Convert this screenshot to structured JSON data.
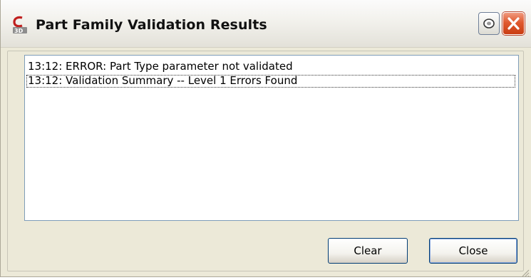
{
  "window": {
    "title": "Part Family Validation Results",
    "app_icon": "civil-3d-icon",
    "pin_icon": "pin-icon",
    "close_icon": "close-icon",
    "close_color": "#d9522a"
  },
  "results": {
    "items": [
      {
        "text": "13:12:  ERROR: Part Type parameter not validated"
      },
      {
        "text": "13:12:  Validation Summary -- Level 1 Errors Found"
      }
    ]
  },
  "buttons": {
    "clear_label": "Clear",
    "close_label": "Close"
  }
}
